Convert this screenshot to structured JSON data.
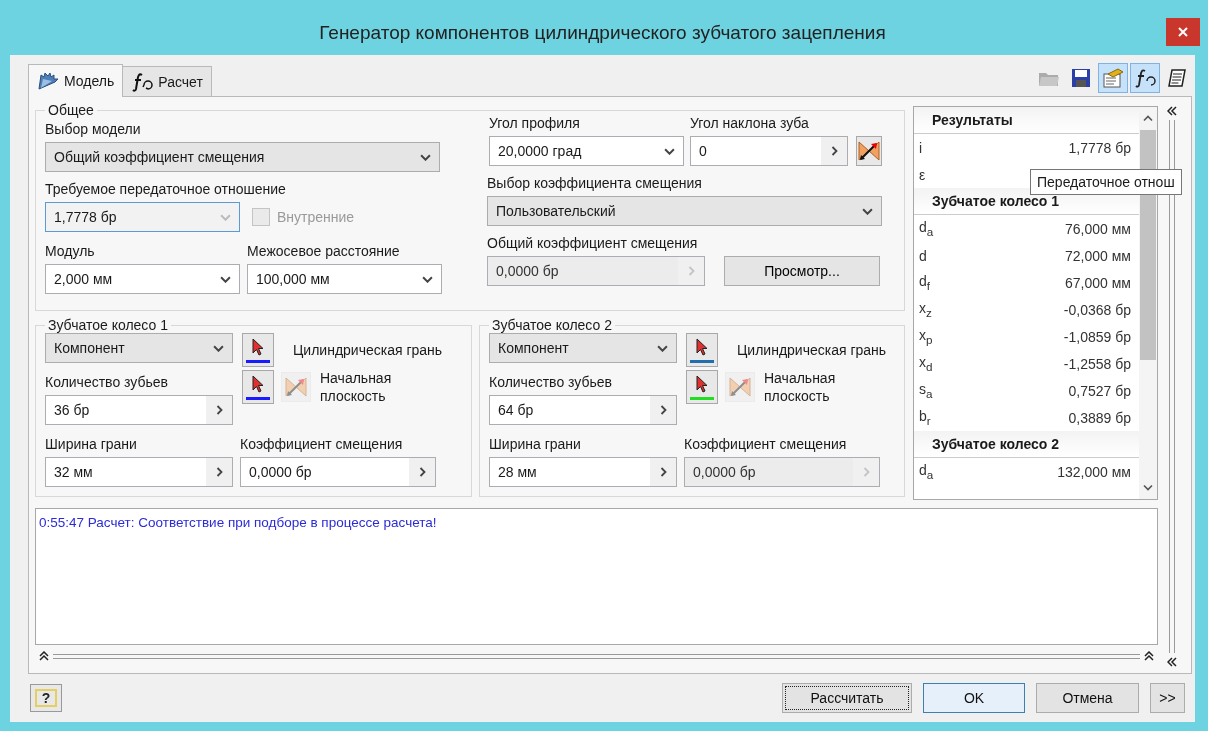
{
  "window": {
    "title": "Генератор компонентов цилиндрического зубчатого зацепления"
  },
  "tabs": [
    {
      "label": "Модель",
      "selected": true,
      "kind": "gear"
    },
    {
      "label": "Расчет",
      "selected": false,
      "kind": "function"
    }
  ],
  "toolbar": [
    {
      "kind": "folder",
      "disabled": true,
      "pressed": false
    },
    {
      "kind": "save",
      "disabled": false,
      "pressed": false
    },
    {
      "kind": "properties",
      "disabled": false,
      "pressed": true
    },
    {
      "kind": "function",
      "disabled": false,
      "pressed": true
    },
    {
      "kind": "notes",
      "disabled": false,
      "pressed": false
    }
  ],
  "general": {
    "title": "Общее",
    "model": {
      "label": "Выбор модели",
      "value": "Общий коэффициент смещения",
      "kind": "select",
      "disabled": false
    },
    "ratio": {
      "label": "Требуемое передаточное отношение",
      "value": "1,7778 бр",
      "kind": "combo",
      "disabled": true,
      "focused": true
    },
    "internal": {
      "label": "Внутренние",
      "checked": false,
      "disabled": true
    },
    "module": {
      "label": "Модуль",
      "value": "2,000 мм",
      "kind": "combo",
      "disabled": false
    },
    "center_distance": {
      "label": "Межосевое расстояние",
      "value": "100,000 мм",
      "kind": "combo",
      "disabled": false
    },
    "pressure_angle": {
      "label": "Угол профиля",
      "value": "20,0000 град",
      "kind": "combo",
      "disabled": false
    },
    "helix_angle": {
      "label": "Угол наклона зуба",
      "value": "0",
      "kind": "spin",
      "disabled": false
    },
    "flip_button": {
      "disabled": false
    },
    "shift_choice": {
      "label": "Выбор коэффициента смещения",
      "value": "Пользовательский",
      "kind": "select",
      "disabled": false
    },
    "total_shift": {
      "label": "Общий коэффициент смещения",
      "value": "0,0000 бр",
      "kind": "spin",
      "disabled": true
    },
    "preview_button": "Просмотр..."
  },
  "gears": [
    {
      "title": "Зубчатое колесо 1",
      "component": {
        "value": "Компонент",
        "kind": "select",
        "disabled": false
      },
      "teeth": {
        "label": "Количество зубьев",
        "value": "36 бр",
        "kind": "spin",
        "disabled": false
      },
      "face_pick": {
        "label": "Цилиндрическая грань",
        "color": "#1a1aff"
      },
      "plane_pick": {
        "label": "Начальная плоскость",
        "color": "#1a1aff",
        "flip_disabled": true
      },
      "width": {
        "label": "Ширина грани",
        "value": "32 мм",
        "kind": "spin",
        "disabled": false
      },
      "shift": {
        "label": "Коэффициент смещения",
        "value": "0,0000 бр",
        "kind": "spin",
        "disabled": false
      }
    },
    {
      "title": "Зубчатое колесо 2",
      "component": {
        "value": "Компонент",
        "kind": "select",
        "disabled": false
      },
      "teeth": {
        "label": "Количество зубьев",
        "value": "64 бр",
        "kind": "spin",
        "disabled": false
      },
      "face_pick": {
        "label": "Цилиндрическая грань",
        "color": "#1f6fae"
      },
      "plane_pick": {
        "label": "Начальная плоскость",
        "color": "#22dd22",
        "flip_disabled": true
      },
      "width": {
        "label": "Ширина грани",
        "value": "28 мм",
        "kind": "spin",
        "disabled": false
      },
      "shift": {
        "label": "Коэффициент смещения",
        "value": "0,0000 бр",
        "kind": "spin",
        "disabled": true
      }
    }
  ],
  "results": {
    "sections": [
      {
        "title": "Результаты",
        "rows": [
          {
            "name": "i",
            "value": "1,7778 бр"
          },
          {
            "name": "ε"
          }
        ]
      },
      {
        "title": "Зубчатое колесо 1",
        "rows": [
          {
            "name": "d$_{a}$",
            "value": "76,000 мм"
          },
          {
            "name": "d",
            "value": "72,000 мм"
          },
          {
            "name": "d$_{f}$",
            "value": "67,000 мм"
          },
          {
            "name": "x$_{z}$",
            "value": "-0,0368 бр"
          },
          {
            "name": "x$_{p}$",
            "value": "-1,0859 бр"
          },
          {
            "name": "x$_{d}$",
            "value": "-1,2558 бр"
          },
          {
            "name": "s$_{a}$",
            "value": "0,7527 бр"
          },
          {
            "name": "b$_{r}$",
            "value": "0,3889 бр"
          }
        ]
      },
      {
        "title": "Зубчатое колесо 2",
        "rows": [
          {
            "name": "d$_{a}$",
            "value": "132,000 мм"
          }
        ]
      }
    ],
    "tooltip": "Передаточное отнош"
  },
  "message": "0:55:47 Расчет: Соответствие при подборе в процессе расчета!",
  "help_button": "?",
  "buttons": [
    {
      "label": "Рассчитать",
      "kind": "focused"
    },
    {
      "label": "OK",
      "kind": "default"
    },
    {
      "label": "Отмена",
      "kind": "normal"
    },
    {
      "label": ">>",
      "kind": "more"
    }
  ]
}
